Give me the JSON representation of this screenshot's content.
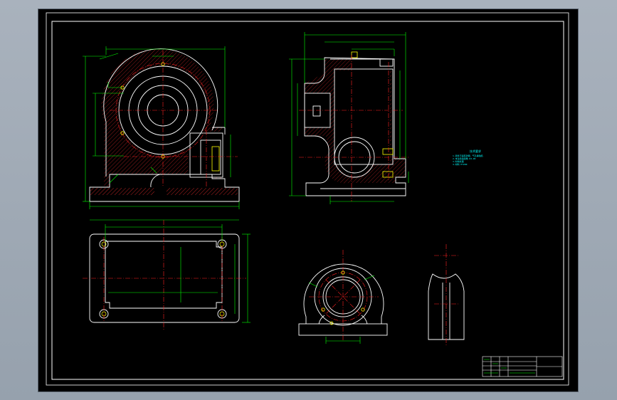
{
  "drawing": {
    "notes": {
      "title": "技术要求",
      "lines": [
        "1.铸件不得有砂眼、气孔等缺陷",
        "2.未注铸造圆角 R3-R5",
        "3.时效处理",
        "4.材料 HT200"
      ]
    },
    "colors": {
      "background": "#000000",
      "outline": "#ffffff",
      "dimension": "#00ff00",
      "center_line": "#ff2020",
      "hatch": "#ff3030",
      "frame": "#ffffff",
      "annotation": "#00ffff",
      "hole": "#ffff00"
    }
  }
}
